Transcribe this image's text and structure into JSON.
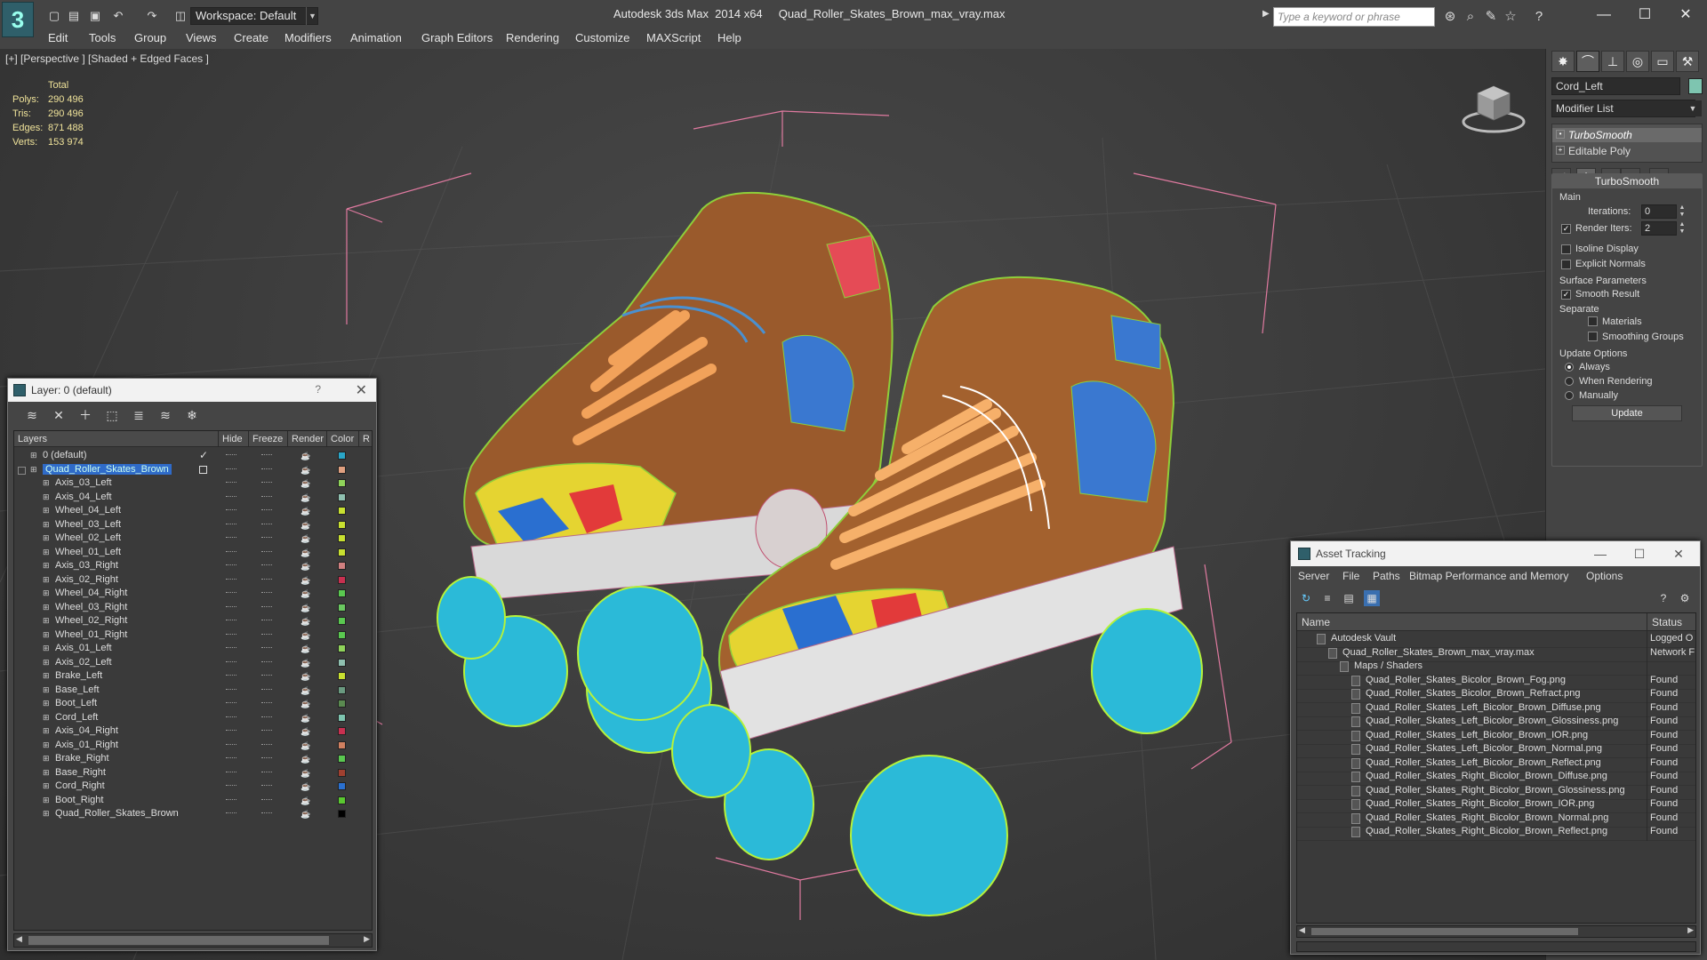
{
  "app": {
    "title": "Autodesk 3ds Max  2014 x64     Quad_Roller_Skates_Brown_max_vray.max",
    "workspace": "Workspace: Default",
    "search_placeholder": "Type a keyword or phrase"
  },
  "menu": [
    "Edit",
    "Tools",
    "Group",
    "Views",
    "Create",
    "Modifiers",
    "Animation",
    "Graph Editors",
    "Rendering",
    "Customize",
    "MAXScript",
    "Help"
  ],
  "viewport": {
    "label": "[+] [Perspective ] [Shaded + Edged Faces ]",
    "stats": {
      "header": "Total",
      "polys_label": "Polys:",
      "polys": "290 496",
      "tris_label": "Tris:",
      "tris": "290 496",
      "edges_label": "Edges:",
      "edges": "871 488",
      "verts_label": "Verts:",
      "verts": "153 974"
    }
  },
  "command_panel": {
    "object_name": "Cord_Left",
    "modifier_list": "Modifier List",
    "stack": [
      "TurboSmooth",
      "Editable Poly"
    ],
    "rollout_title": "TurboSmooth",
    "main_label": "Main",
    "iterations_label": "Iterations:",
    "iterations": "0",
    "render_iters_label": "Render Iters:",
    "render_iters": "2",
    "isoline_label": "Isoline Display",
    "explicit_label": "Explicit Normals",
    "surface_label": "Surface Parameters",
    "smooth_result_label": "Smooth Result",
    "separate_label": "Separate",
    "materials_label": "Materials",
    "smoothing_groups_label": "Smoothing Groups",
    "update_options_label": "Update Options",
    "always_label": "Always",
    "when_rendering_label": "When Rendering",
    "manually_label": "Manually",
    "update_button": "Update"
  },
  "layer_window": {
    "title": "Layer: 0 (default)",
    "columns": [
      "Layers",
      "Hide",
      "Freeze",
      "Render",
      "Color",
      "R"
    ],
    "rows": [
      {
        "name": "0 (default)",
        "level": 0,
        "color": "#2aa6c8"
      },
      {
        "name": "Quad_Roller_Skates_Brown",
        "level": 0,
        "color": "#e0a080",
        "selected": true
      },
      {
        "name": "Axis_03_Left",
        "level": 1,
        "color": "#8fd35a"
      },
      {
        "name": "Axis_04_Left",
        "level": 1,
        "color": "#8fc0b0"
      },
      {
        "name": "Wheel_04_Left",
        "level": 1,
        "color": "#c8e030"
      },
      {
        "name": "Wheel_03_Left",
        "level": 1,
        "color": "#c8e030"
      },
      {
        "name": "Wheel_02_Left",
        "level": 1,
        "color": "#c8e030"
      },
      {
        "name": "Wheel_01_Left",
        "level": 1,
        "color": "#c8e030"
      },
      {
        "name": "Axis_03_Right",
        "level": 1,
        "color": "#d08080"
      },
      {
        "name": "Axis_02_Right",
        "level": 1,
        "color": "#c83050"
      },
      {
        "name": "Wheel_04_Right",
        "level": 1,
        "color": "#5ac850"
      },
      {
        "name": "Wheel_03_Right",
        "level": 1,
        "color": "#6ac860"
      },
      {
        "name": "Wheel_02_Right",
        "level": 1,
        "color": "#5ac850"
      },
      {
        "name": "Wheel_01_Right",
        "level": 1,
        "color": "#5ac850"
      },
      {
        "name": "Axis_01_Left",
        "level": 1,
        "color": "#8fd35a"
      },
      {
        "name": "Axis_02_Left",
        "level": 1,
        "color": "#8fc0b0"
      },
      {
        "name": "Brake_Left",
        "level": 1,
        "color": "#c8e030"
      },
      {
        "name": "Base_Left",
        "level": 1,
        "color": "#6a9a80"
      },
      {
        "name": "Boot_Left",
        "level": 1,
        "color": "#5a8a50"
      },
      {
        "name": "Cord_Left",
        "level": 1,
        "color": "#7ec5b0"
      },
      {
        "name": "Axis_04_Right",
        "level": 1,
        "color": "#c83050"
      },
      {
        "name": "Axis_01_Right",
        "level": 1,
        "color": "#d08060"
      },
      {
        "name": "Brake_Right",
        "level": 1,
        "color": "#5ac850"
      },
      {
        "name": "Base_Right",
        "level": 1,
        "color": "#a04030"
      },
      {
        "name": "Cord_Right",
        "level": 1,
        "color": "#2a70d0"
      },
      {
        "name": "Boot_Right",
        "level": 1,
        "color": "#5ac830"
      },
      {
        "name": "Quad_Roller_Skates_Brown",
        "level": 1,
        "color": "#000000"
      }
    ]
  },
  "asset_tracking": {
    "title": "Asset Tracking",
    "menu": [
      "Server",
      "File",
      "Paths",
      "Bitmap Performance and Memory",
      "Options"
    ],
    "col_name": "Name",
    "col_status": "Status",
    "rows": [
      {
        "name": "Autodesk Vault",
        "level": 0,
        "status": "Logged O"
      },
      {
        "name": "Quad_Roller_Skates_Brown_max_vray.max",
        "level": 1,
        "status": "Network F"
      },
      {
        "name": "Maps / Shaders",
        "level": 2,
        "status": ""
      },
      {
        "name": "Quad_Roller_Skates_Bicolor_Brown_Fog.png",
        "level": 3,
        "status": "Found"
      },
      {
        "name": "Quad_Roller_Skates_Bicolor_Brown_Refract.png",
        "level": 3,
        "status": "Found"
      },
      {
        "name": "Quad_Roller_Skates_Left_Bicolor_Brown_Diffuse.png",
        "level": 3,
        "status": "Found"
      },
      {
        "name": "Quad_Roller_Skates_Left_Bicolor_Brown_Glossiness.png",
        "level": 3,
        "status": "Found"
      },
      {
        "name": "Quad_Roller_Skates_Left_Bicolor_Brown_IOR.png",
        "level": 3,
        "status": "Found"
      },
      {
        "name": "Quad_Roller_Skates_Left_Bicolor_Brown_Normal.png",
        "level": 3,
        "status": "Found"
      },
      {
        "name": "Quad_Roller_Skates_Left_Bicolor_Brown_Reflect.png",
        "level": 3,
        "status": "Found"
      },
      {
        "name": "Quad_Roller_Skates_Right_Bicolor_Brown_Diffuse.png",
        "level": 3,
        "status": "Found"
      },
      {
        "name": "Quad_Roller_Skates_Right_Bicolor_Brown_Glossiness.png",
        "level": 3,
        "status": "Found"
      },
      {
        "name": "Quad_Roller_Skates_Right_Bicolor_Brown_IOR.png",
        "level": 3,
        "status": "Found"
      },
      {
        "name": "Quad_Roller_Skates_Right_Bicolor_Brown_Normal.png",
        "level": 3,
        "status": "Found"
      },
      {
        "name": "Quad_Roller_Skates_Right_Bicolor_Brown_Reflect.png",
        "level": 3,
        "status": "Found"
      }
    ]
  }
}
